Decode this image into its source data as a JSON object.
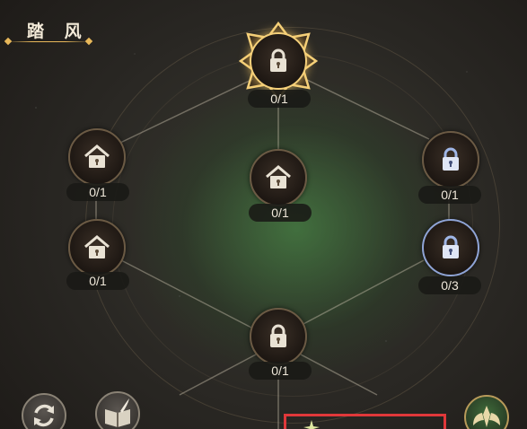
{
  "header": {
    "title": "踏 风"
  },
  "nodes": [
    {
      "id": "top",
      "count": "0/1",
      "state": "selected-locked"
    },
    {
      "id": "center",
      "count": "0/1",
      "state": "locked"
    },
    {
      "id": "left-upper",
      "count": "0/1",
      "state": "locked"
    },
    {
      "id": "left-lower",
      "count": "0/1",
      "state": "locked"
    },
    {
      "id": "right-upper",
      "count": "0/1",
      "state": "locked-blue"
    },
    {
      "id": "right-lower",
      "count": "0/3",
      "state": "locked-blue"
    },
    {
      "id": "bottom",
      "count": "0/1",
      "state": "locked"
    }
  ],
  "bottom_bar": {
    "refresh_icon": "refresh-icon",
    "book_icon": "book-quill-icon",
    "emblem_icon": "wing-emblem-icon"
  },
  "colors": {
    "accent_gold": "#e8b85a",
    "highlight_red": "#e0383a",
    "glow_green": "#4a8c4a"
  }
}
